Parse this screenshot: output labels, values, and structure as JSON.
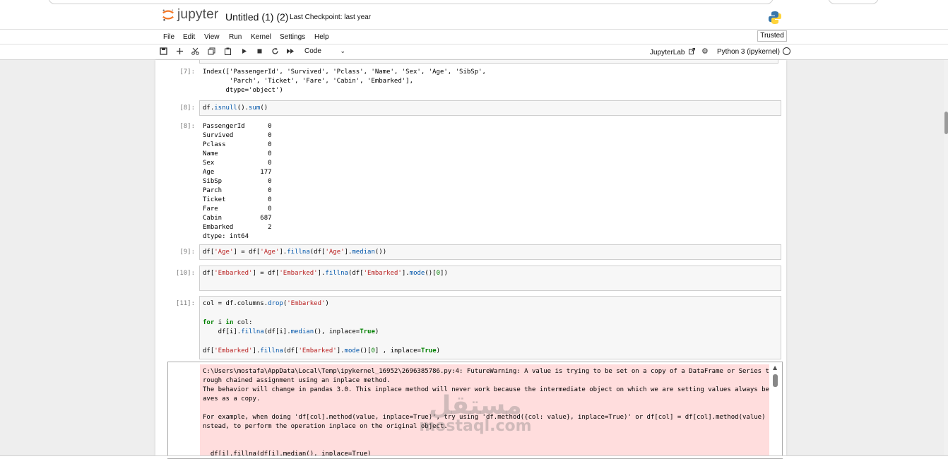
{
  "header": {
    "logo_text": "jupyter",
    "notebook_title": "Untitled (1) (2)",
    "checkpoint": "Last Checkpoint: last year"
  },
  "menu": {
    "items": [
      "File",
      "Edit",
      "View",
      "Run",
      "Kernel",
      "Settings",
      "Help"
    ],
    "trusted": "Trusted"
  },
  "toolbar": {
    "icons": [
      "save-icon",
      "add-cell-icon",
      "cut-icon",
      "copy-icon",
      "paste-icon",
      "run-icon",
      "stop-icon",
      "restart-icon",
      "fast-forward-icon"
    ],
    "cell_type": "Code",
    "jupyterlab": "JupyterLab",
    "kernel": "Python 3 (ipykernel)"
  },
  "cells": {
    "c7": {
      "prompt": "[7]:",
      "output": "Index(['PassengerId', 'Survived', 'Pclass', 'Name', 'Sex', 'Age', 'SibSp',\n       'Parch', 'Ticket', 'Fare', 'Cabin', 'Embarked'],\n      dtype='object')"
    },
    "c8": {
      "prompt": "[8]:",
      "code": "df.isnull().sum()",
      "output": "PassengerId      0\nSurvived         0\nPclass           0\nName             0\nSex              0\nAge            177\nSibSp            0\nParch            0\nTicket           0\nFare             0\nCabin          687\nEmbarked         2\ndtype: int64"
    },
    "c9": {
      "prompt": "[9]:",
      "code": "df['Age'] = df['Age'].fillna(df['Age'].median())"
    },
    "c10": {
      "prompt": "[10]:",
      "code": "df['Embarked'] = df['Embarked'].fillna(df['Embarked'].mode()[0])"
    },
    "c11": {
      "prompt": "[11]:",
      "code_line1": "col = df.columns.drop('Embarked')",
      "code_line2": "for i in col:",
      "code_line3": "    df[i].fillna(df[i].median(), inplace=True)",
      "code_line4": "df['Embarked'].fillna(df['Embarked'].mode()[0] , inplace=True)",
      "stderr": "C:\\Users\\mostafa\\AppData\\Local\\Temp\\ipykernel_16952\\2696385786.py:4: FutureWarning: A value is trying to be set on a copy of a DataFrame or Series th\nrough chained assignment using an inplace method.\nThe behavior will change in pandas 3.0. This inplace method will never work because the intermediate object on which we are setting values always beh\naves as a copy.\n\nFor example, when doing 'df[col].method(value, inplace=True)', try using 'df.method({col: value}, inplace=True)' or df[col] = df[col].method(value) i\nnstead, to perform the operation inplace on the original object.\n\n\n  df[i].fillna(df[i].median(), inplace=True)"
    }
  },
  "watermark": {
    "arabic": "مستقل",
    "latin": "mostaql.com"
  },
  "colors": {
    "keyword": "#008000",
    "string": "#ba2121",
    "function": "#0055aa",
    "stderr_bg": "#ffdddd",
    "logo_orange": "#f37726"
  }
}
